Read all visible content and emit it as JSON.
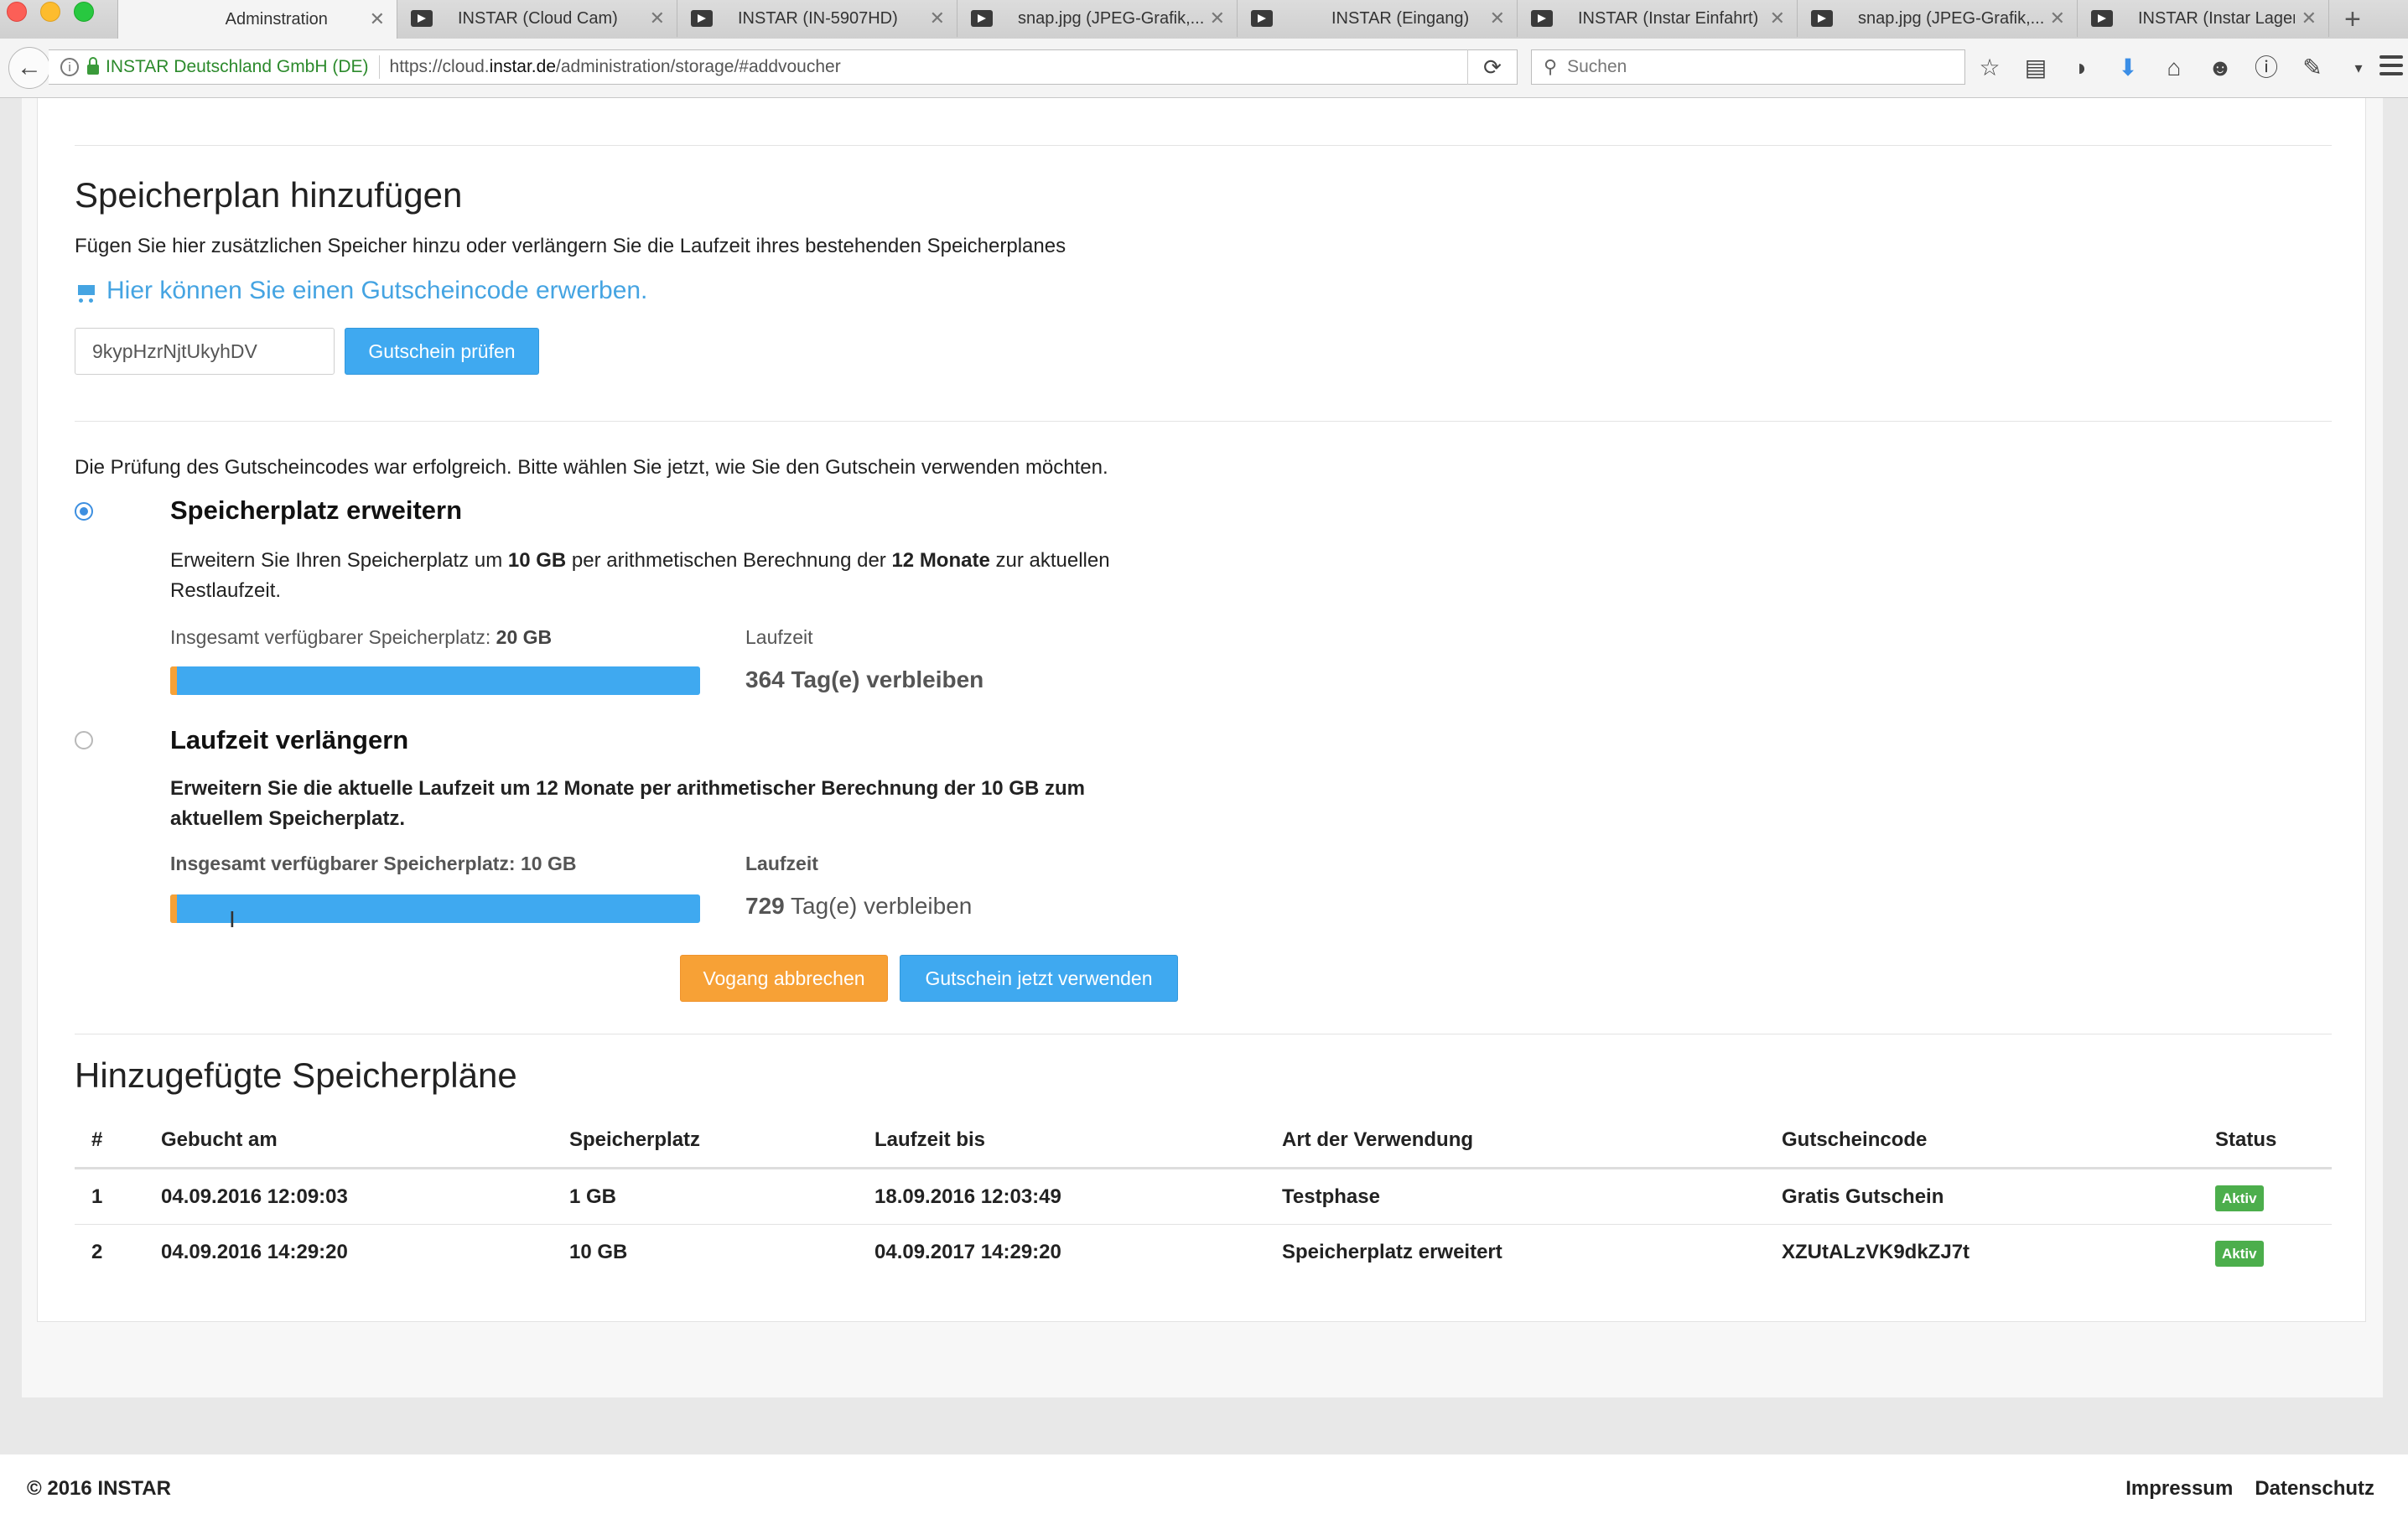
{
  "browser": {
    "tabs": [
      {
        "label": "Adminstration",
        "active": true
      },
      {
        "label": "INSTAR (Cloud Cam)"
      },
      {
        "label": "INSTAR (IN-5907HD)"
      },
      {
        "label": "snap.jpg (JPEG-Grafik,..."
      },
      {
        "label": "INSTAR (Eingang)"
      },
      {
        "label": "INSTAR (Instar Einfahrt)"
      },
      {
        "label": "snap.jpg (JPEG-Grafik,..."
      },
      {
        "label": "INSTAR (Instar Lager)"
      }
    ],
    "identity": "INSTAR Deutschland GmbH (DE)",
    "url_prefix": "https://cloud.",
    "url_domain": "instar.de",
    "url_path": "/administration/storage/#addvoucher",
    "search_placeholder": "Suchen"
  },
  "add_plan": {
    "title": "Speicherplan hinzufügen",
    "description": "Fügen Sie hier zusätzlichen Speicher hinzu oder verlängern Sie die Laufzeit ihres bestehenden Speicherplanes",
    "buy_link": "Hier können Sie einen Gutscheincode erwerben.",
    "voucher_value": "9kypHzrNjtUkyhDV",
    "check_button": "Gutschein prüfen"
  },
  "result": {
    "message": "Die Prüfung des Gutscheincodes war erfolgreich. Bitte wählen Sie jetzt, wie Sie den Gutschein verwenden möchten.",
    "options": [
      {
        "title": "Speicherplatz erweitern",
        "selected": true,
        "text_pre": "Erweitern Sie Ihren Speicherplatz um ",
        "text_b1": "10 GB",
        "text_mid": " per arithmetischen Berechnung der ",
        "text_b2": "12 Monate",
        "text_post": " zur aktuellen Restlaufzeit.",
        "storage_label": "Insgesamt verfügbarer Speicherplatz: ",
        "storage_value": "20 GB",
        "runtime_label": "Laufzeit",
        "runtime_value": "364 Tag(e) verbleiben",
        "progress": 0.01
      },
      {
        "title": "Laufzeit verlängern",
        "selected": false,
        "text": "Erweitern Sie die aktuelle Laufzeit um 12 Monate per arithmetischer Berechnung der 10 GB zum aktuellem Speicherplatz.",
        "storage_label": "Insgesamt verfügbarer Speicherplatz: 10 GB",
        "runtime_label": "Laufzeit",
        "runtime_days": "729",
        "runtime_suffix": " Tag(e) verbleiben",
        "progress": 0.01
      }
    ],
    "cancel_button": "Vogang abbrechen",
    "use_button": "Gutschein jetzt verwenden"
  },
  "plans": {
    "title": "Hinzugefügte Speicherpläne",
    "columns": [
      "#",
      "Gebucht am",
      "Speicherplatz",
      "Laufzeit bis",
      "Art der Verwendung",
      "Gutscheincode",
      "Status"
    ],
    "rows": [
      [
        "1",
        "04.09.2016 12:09:03",
        "1 GB",
        "18.09.2016 12:03:49",
        "Testphase",
        "Gratis Gutschein",
        "Aktiv"
      ],
      [
        "2",
        "04.09.2016 14:29:20",
        "10 GB",
        "04.09.2017 14:29:20",
        "Speicherplatz erweitert",
        "XZUtALzVK9dkZJ7t",
        "Aktiv"
      ]
    ]
  },
  "footer": {
    "copyright": "© 2016 INSTAR",
    "impressum": "Impressum",
    "datenschutz": "Datenschutz"
  },
  "colors": {
    "accent": "#3fa9f0",
    "cancel": "#f7a136",
    "status_active": "#4cae4c",
    "link": "#45a4e2"
  }
}
